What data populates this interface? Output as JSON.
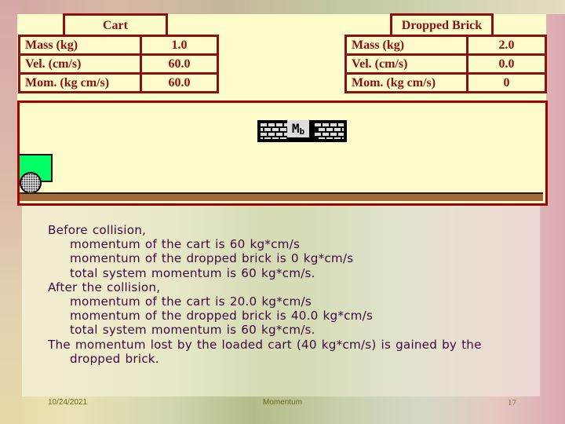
{
  "slide": {
    "cart_table": {
      "title": "Cart",
      "rows": [
        {
          "label": "Mass (kg)",
          "value": "1.0"
        },
        {
          "label": "Vel. (cm/s)",
          "value": "60.0"
        },
        {
          "label": "Mom. (kg cm/s)",
          "value": "60.0"
        }
      ]
    },
    "brick_table": {
      "title": "Dropped Brick",
      "rows": [
        {
          "label": "Mass (kg)",
          "value": "2.0"
        },
        {
          "label": "Vel. (cm/s)",
          "value": "0.0"
        },
        {
          "label": "Mom. (kg cm/s)",
          "value": "0"
        }
      ]
    },
    "brick_label": "M",
    "brick_label_sub": "b",
    "colors": {
      "table_border": "#8b1010",
      "sim_background": "#fffccc",
      "cart": "#00ff66",
      "ground": "#a06a3c",
      "text": "#3c0a3c"
    },
    "explanation": [
      {
        "indent": 0,
        "text": "Before collision,"
      },
      {
        "indent": 1,
        "text": "momentum of the cart is 60 kg*cm/s"
      },
      {
        "indent": 1,
        "text": "momentum of the dropped brick is 0 kg*cm/s"
      },
      {
        "indent": 1,
        "text": "total system momentum is 60 kg*cm/s."
      },
      {
        "indent": 0,
        "text": "After the collision,"
      },
      {
        "indent": 1,
        "text": "momentum of the cart is 20.0 kg*cm/s"
      },
      {
        "indent": 1,
        "text": "momentum of the dropped brick is 40.0 kg*cm/s"
      },
      {
        "indent": 1,
        "text": "total system momentum is 60 kg*cm/s."
      },
      {
        "indent": 0,
        "text": "The momentum lost by the loaded cart (40 kg*cm/s) is gained by the"
      },
      {
        "indent": 1,
        "text": "dropped brick."
      }
    ],
    "footer": {
      "date": "10/24/2021",
      "title": "Momentum",
      "page": "17"
    }
  }
}
